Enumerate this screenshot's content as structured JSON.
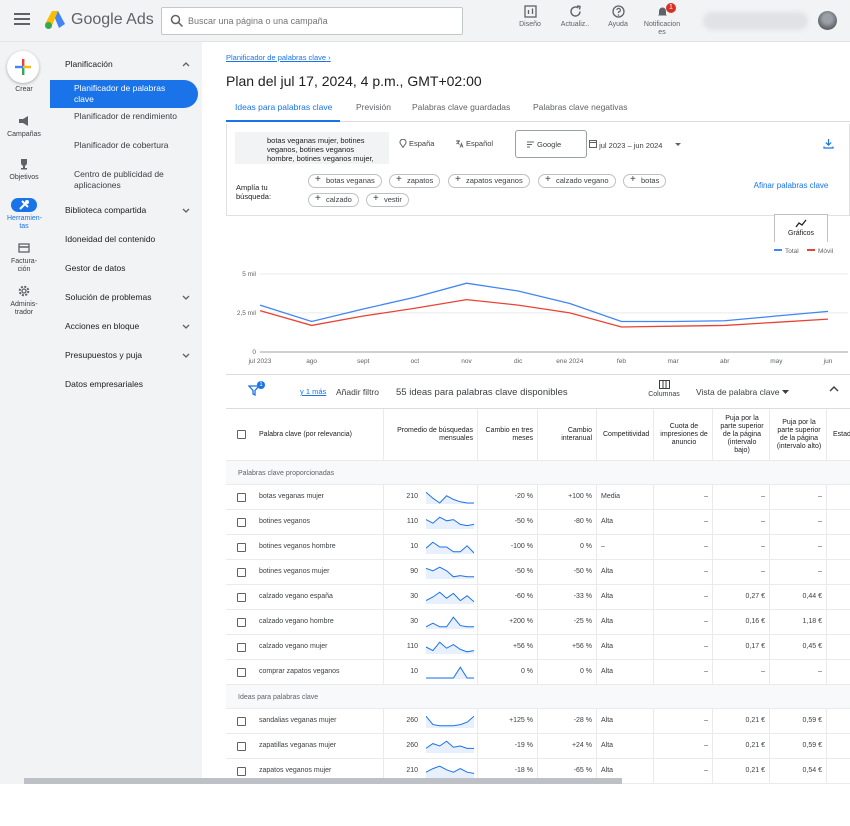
{
  "topbar": {
    "brand": "Google Ads",
    "search_placeholder": "Buscar una página o una campaña",
    "actions": [
      {
        "label": "Diseño",
        "icon": "bar-chart-icon"
      },
      {
        "label": "Actualiz..",
        "icon": "refresh-icon"
      },
      {
        "label": "Ayuda",
        "icon": "help-icon"
      },
      {
        "label": "Notificacion es",
        "icon": "bell-icon",
        "badge": "1"
      }
    ]
  },
  "rail": {
    "create": "Crear",
    "items": [
      {
        "label": "Campañas",
        "icon": "megaphone-icon"
      },
      {
        "label": "Objetivos",
        "icon": "trophy-icon"
      },
      {
        "label": "Herramien- tas",
        "icon": "tools-icon",
        "active": true
      },
      {
        "label": "Factura- ción",
        "icon": "credit-card-icon"
      },
      {
        "label": "Adminis- trador",
        "icon": "gear-icon"
      }
    ]
  },
  "nav": {
    "planning": "Planificación",
    "active": "Planificador de palabras clave",
    "subs": [
      "Planificador de rendimiento",
      "Planificador de cobertura",
      "Centro de publicidad de aplicaciones"
    ],
    "sections": [
      "Biblioteca compartida",
      "Idoneidad del contenido",
      "Gestor de datos",
      "Solución de problemas",
      "Acciones en bloque",
      "Presupuestos y puja",
      "Datos empresariales"
    ]
  },
  "breadcrumb": "Planificador de palabras clave",
  "page_title": "Plan del jul 17, 2024, 4 p.m., GMT+02:00",
  "tabs": [
    "Ideas para palabras clave",
    "Previsión",
    "Palabras clave guardadas",
    "Palabras clave negativas"
  ],
  "filters": {
    "keywords": "botas veganas mujer, botines veganos, botines veganos hombre, botines veganos mujer,",
    "location": "España",
    "language": "Español",
    "network": "Google",
    "date_range": "jul 2023 – jun 2024",
    "broaden_label": "Amplía tu búsqueda:",
    "chips": [
      "botas veganas",
      "zapatos",
      "zapatos veganos",
      "calzado vegano",
      "botas",
      "calzado",
      "vestir"
    ],
    "refine": "Afinar palabras clave"
  },
  "chart": {
    "button": "Gráficos",
    "legend_total": "Total",
    "legend_mobile": "Móvil",
    "color_total": "#4285f4",
    "color_mobile": "#ea4335"
  },
  "chart_data": {
    "type": "line",
    "x": [
      "jul 2023",
      "ago",
      "sept",
      "oct",
      "nov",
      "dic",
      "ene 2024",
      "feb",
      "mar",
      "abr",
      "may",
      "jun"
    ],
    "yticks": [
      "5 mil",
      "2,5 mil",
      "0"
    ],
    "ylim": [
      0,
      5500
    ],
    "series": [
      {
        "name": "Total",
        "values": [
          3000,
          1950,
          2750,
          3500,
          4400,
          3900,
          3100,
          1950,
          1950,
          2000,
          2300,
          2600
        ]
      },
      {
        "name": "Móvil",
        "values": [
          2650,
          1700,
          2300,
          2800,
          3350,
          3000,
          2500,
          1600,
          1650,
          1700,
          1900,
          2100
        ]
      }
    ]
  },
  "toolbar": {
    "filter_badge": "1",
    "more": "y 1 más",
    "add_filter": "Añadir filtro",
    "count": "55 ideas para palabras clave disponibles",
    "columns": "Columnas",
    "view": "Vista de palabra clave"
  },
  "table": {
    "headers": [
      "Palabra clave (por relevancia)",
      "Promedio de búsquedas mensuales",
      "Cambio en tres meses",
      "Cambio interanual",
      "Competitividad",
      "Cuota de impresiones de anuncio",
      "Puja por la parte superior de la página (intervalo bajo)",
      "Puja por la parte superior de la página (intervalo alto)",
      "Estado"
    ],
    "section1": "Palabras clave proporcionadas",
    "section2": "Ideas para palabras clave",
    "provided": [
      [
        "botas veganas mujer",
        "210",
        "-20 %",
        "+100 %",
        "Media",
        "–",
        "–",
        "–"
      ],
      [
        "botines veganos",
        "110",
        "-50 %",
        "-80 %",
        "Alta",
        "–",
        "–",
        "–"
      ],
      [
        "botines veganos hombre",
        "10",
        "-100 %",
        "0 %",
        "–",
        "–",
        "–",
        "–"
      ],
      [
        "botines veganos mujer",
        "90",
        "-50 %",
        "-50 %",
        "Alta",
        "–",
        "–",
        "–"
      ],
      [
        "calzado vegano españa",
        "30",
        "-60 %",
        "-33 %",
        "Alta",
        "–",
        "0,27 €",
        "0,44 €"
      ],
      [
        "calzado vegano hombre",
        "30",
        "+200 %",
        "-25 %",
        "Alta",
        "–",
        "0,16 €",
        "1,18 €"
      ],
      [
        "calzado vegano mujer",
        "110",
        "+56 %",
        "+56 %",
        "Alta",
        "–",
        "0,17 €",
        "0,45 €"
      ],
      [
        "comprar zapatos veganos",
        "10",
        "0 %",
        "0 %",
        "Alta",
        "–",
        "–",
        "–"
      ]
    ],
    "ideas": [
      [
        "sandalias veganas mujer",
        "260",
        "+125 %",
        "-28 %",
        "Alta",
        "–",
        "0,21 €",
        "0,59 €"
      ],
      [
        "zapatillas veganas mujer",
        "260",
        "-19 %",
        "+24 %",
        "Alta",
        "–",
        "0,21 €",
        "0,59 €"
      ],
      [
        "zapatos veganos mujer",
        "210",
        "-18 %",
        "-65 %",
        "Alta",
        "–",
        "0,21 €",
        "0,54 €"
      ]
    ]
  }
}
